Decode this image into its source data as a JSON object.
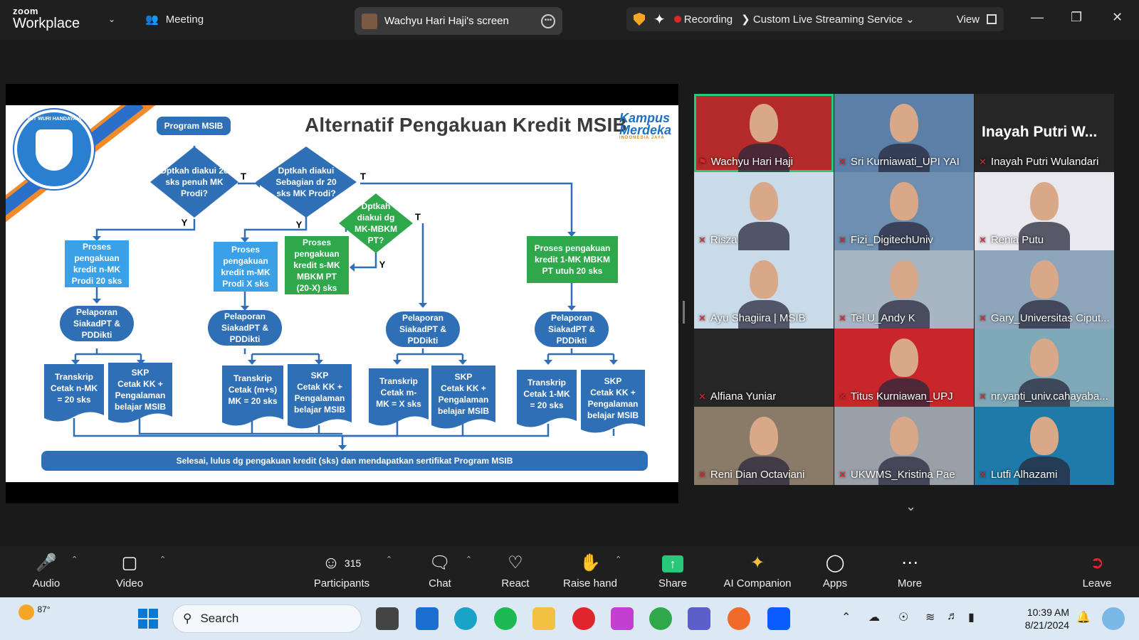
{
  "topbar": {
    "brand_line1": "zoom",
    "brand_line2": "Workplace",
    "meeting_label": "Meeting",
    "shared_screen_label": "Wachyu Hari Haji's screen",
    "recording_label": "Recording",
    "streaming_label": "Custom Live Streaming Service",
    "view_label": "View"
  },
  "slide": {
    "title": "Alternatif Pengakuan Kredit MSIB",
    "brand_top": "Kampus",
    "brand_bottom": "Merdeka",
    "brand_tag": "INDONESIA JAYA",
    "logo_text": "TUT WURI HANDAYANI",
    "nodes": {
      "program": "Program MSIB",
      "d1": [
        "Dptkah diakui 20",
        "sks penuh MK",
        "Prodi?"
      ],
      "d2": [
        "Dptkah diakui",
        "Sebagian dr 20",
        "sks MK Prodi?"
      ],
      "d3": [
        "Dptkah",
        "diakui dg",
        "MK-MBKM",
        "PT?"
      ],
      "p1": [
        "Proses",
        "pengakuan",
        "kredit n-MK",
        "Prodi 20 sks"
      ],
      "p2": [
        "Proses",
        "pengakuan",
        "kredit m-MK",
        "Prodi X sks"
      ],
      "p3": [
        "Proses",
        "pengakuan",
        "kredit s-MK",
        "MBKM PT",
        "(20-X) sks"
      ],
      "p4": [
        "Proses pengakuan",
        "kredit 1-MK MBKM",
        "PT utuh 20 sks"
      ],
      "lapor": [
        "Pelaporan",
        "SiakadPT &",
        "PDDikti"
      ],
      "t1": [
        "Transkrip",
        "Cetak n-MK",
        "= 20 sks"
      ],
      "t2": [
        "Transkrip",
        "Cetak (m+s)",
        "MK = 20 sks"
      ],
      "t3": [
        "Transkrip",
        "Cetak m-",
        "MK = X sks"
      ],
      "t4": [
        "Transkrip",
        "Cetak 1-MK",
        "= 20 sks"
      ],
      "skp": [
        "SKP",
        "Cetak KK +",
        "Pengalaman",
        "belajar MSIB"
      ],
      "final": "Selesai, lulus dg pengakuan kredit (sks) dan mendapatkan sertifikat Program MSIB",
      "yes": "Y",
      "no": "T"
    }
  },
  "participants": [
    {
      "name": "Wachyu Hari Haji",
      "bg": "#b52a2a"
    },
    {
      "name": "Sri Kurniawati_UPI YAI",
      "bg": "#5c7fa8"
    },
    {
      "name": "Inayah Putri Wulandari",
      "display": "Inayah Putri W...",
      "bg": "#262626"
    },
    {
      "name": "Risza",
      "bg": "#c9dbe9"
    },
    {
      "name": "Fizi_DigitechUniv",
      "bg": "#6e8fb0"
    },
    {
      "name": "Renia Putu",
      "bg": "#e8e8ee"
    },
    {
      "name": "Ayu Shagiira | MSIB",
      "bg": "#c9dbe9"
    },
    {
      "name": "Tel U_Andy K",
      "bg": "#a8b6c4"
    },
    {
      "name": "Gary_Universitas Ciput...",
      "bg": "#8ea6bb"
    },
    {
      "name": "Alfiana Yuniar",
      "bg": "#262626"
    },
    {
      "name": "Titus Kurniawan_UPJ",
      "bg": "#c8262a"
    },
    {
      "name": "nr.yanti_univ.cahayaba...",
      "bg": "#7fa9b8"
    },
    {
      "name": "Reni Dian Octaviani",
      "bg": "#8a7a68"
    },
    {
      "name": "UKWMS_Kristina Pae",
      "bg": "#9aa0a8"
    },
    {
      "name": "Lutfi Alhazami",
      "bg": "#1e7aa8"
    }
  ],
  "toolbar": {
    "audio": "Audio",
    "video": "Video",
    "participants": "Participants",
    "participants_count": "315",
    "chat": "Chat",
    "react": "React",
    "raise_hand": "Raise hand",
    "share": "Share",
    "ai_companion": "AI Companion",
    "apps": "Apps",
    "more": "More",
    "leave": "Leave"
  },
  "taskbar": {
    "weather": "87°",
    "search_placeholder": "Search",
    "time": "10:39 AM",
    "date": "8/21/2024"
  },
  "colors": {
    "accent_green": "#29c77a",
    "flow_blue": "#2f6fb5",
    "flow_cyan": "#3aa0e8",
    "flow_green": "#2ea84a",
    "recording_red": "#e0262c"
  }
}
